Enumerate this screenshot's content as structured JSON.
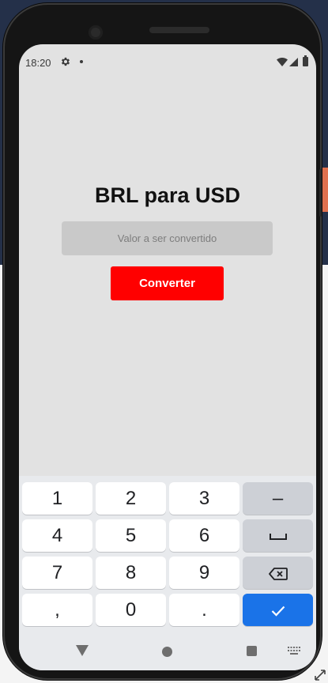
{
  "status_bar": {
    "time": "18:20"
  },
  "main": {
    "title": "BRL para USD",
    "input_placeholder": "Valor a ser convertido",
    "input_value": "",
    "convert_label": "Converter"
  },
  "keyboard": {
    "keys": [
      "1",
      "2",
      "3",
      "4",
      "5",
      "6",
      "7",
      "8",
      "9",
      ",",
      "0",
      "."
    ],
    "minus_label": "–"
  },
  "colors": {
    "accent_button": "#ff0000",
    "done_key": "#1a73e8",
    "screen_bg": "#e2e2e2"
  }
}
